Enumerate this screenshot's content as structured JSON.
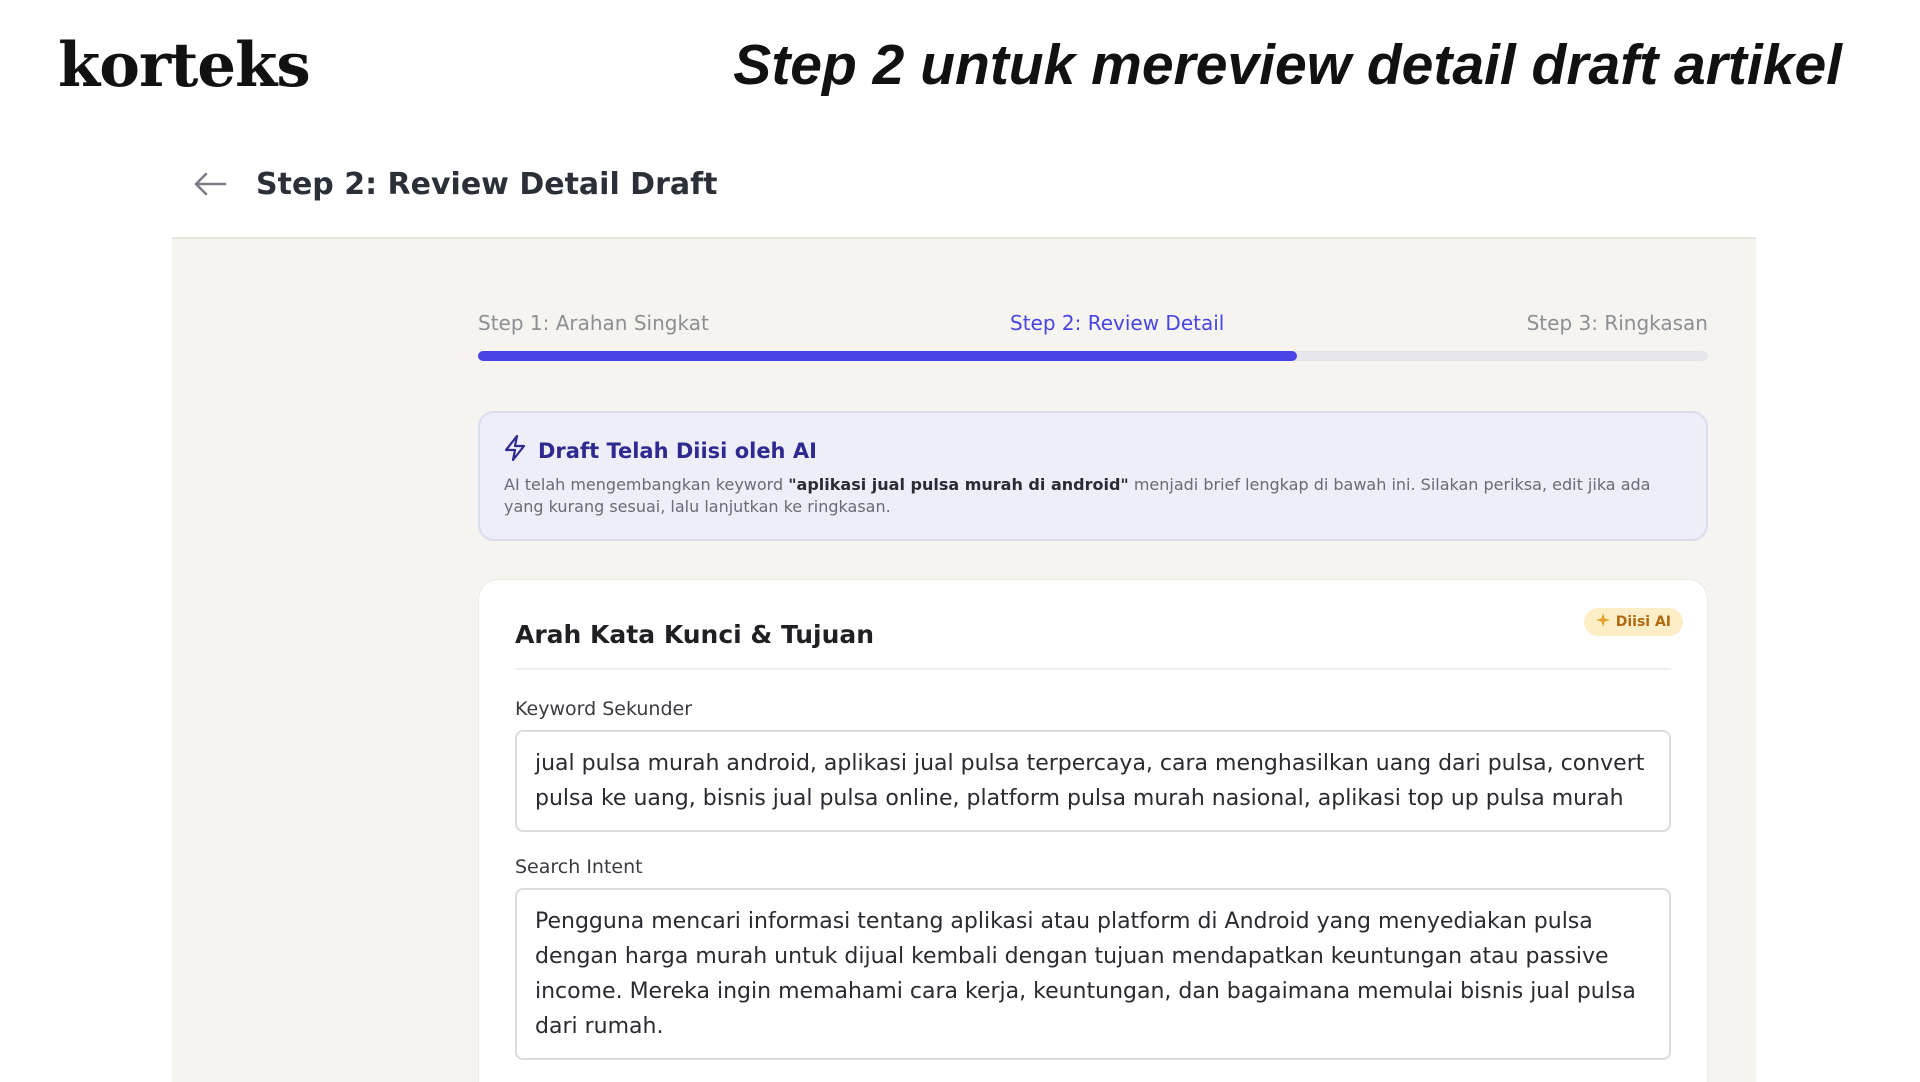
{
  "brand": "korteks",
  "headline": "Step 2 untuk mereview detail draft artikel",
  "page": {
    "back_icon": "arrow-left-icon",
    "title": "Step 2: Review Detail Draft"
  },
  "steps": [
    {
      "label": "Step 1: Arahan Singkat"
    },
    {
      "label": "Step 2: Review Detail"
    },
    {
      "label": "Step 3: Ringkasan"
    }
  ],
  "progress": 0.666,
  "colors": {
    "accent": "#4b43e3",
    "notice_bg": "#eeeef8",
    "badge_bg": "#fdeec8"
  },
  "ai_notice": {
    "icon": "lightning-icon",
    "title": "Draft Telah Diisi oleh AI",
    "text_before": "AI telah mengembangkan keyword ",
    "keyword": "\"aplikasi jual pulsa murah di android\"",
    "text_after": " menjadi brief lengkap di bawah ini. Silakan periksa, edit jika ada yang kurang sesuai, lalu lanjutkan ke ringkasan."
  },
  "card": {
    "title": "Arah Kata Kunci & Tujuan",
    "badge": "Diisi AI",
    "badge_icon": "sparkle-icon",
    "fields": [
      {
        "label": "Keyword Sekunder",
        "value": "jual pulsa murah android, aplikasi jual pulsa terpercaya, cara menghasilkan uang dari pulsa, convert pulsa ke uang, bisnis jual pulsa online, platform pulsa murah nasional, aplikasi top up pulsa murah"
      },
      {
        "label": "Search Intent",
        "value": "Pengguna mencari informasi tentang aplikasi atau platform di Android yang menyediakan pulsa dengan harga murah untuk dijual kembali dengan tujuan mendapatkan keuntungan atau passive income. Mereka ingin memahami cara kerja, keuntungan, dan bagaimana memulai bisnis jual pulsa dari rumah."
      }
    ]
  }
}
